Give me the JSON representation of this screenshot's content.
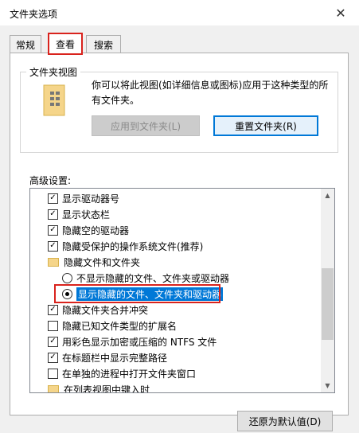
{
  "window": {
    "title": "文件夹选项",
    "close_glyph": "✕"
  },
  "tabs": [
    {
      "label": "常规"
    },
    {
      "label": "查看"
    },
    {
      "label": "搜索"
    }
  ],
  "folder_view": {
    "legend": "文件夹视图",
    "description": "你可以将此视图(如详细信息或图标)应用于这种类型的所有文件夹。",
    "apply_button": "应用到文件夹(L)",
    "reset_button": "重置文件夹(R)"
  },
  "advanced": {
    "label": "高级设置:",
    "items": [
      {
        "label": "显示驱动器号",
        "type": "checkbox",
        "checked": true
      },
      {
        "label": "显示状态栏",
        "type": "checkbox",
        "checked": true
      },
      {
        "label": "隐藏空的驱动器",
        "type": "checkbox",
        "checked": true
      },
      {
        "label": "隐藏受保护的操作系统文件(推荐)",
        "type": "checkbox",
        "checked": true
      },
      {
        "label": "隐藏文件和文件夹",
        "type": "folder"
      },
      {
        "label": "不显示隐藏的文件、文件夹或驱动器",
        "type": "radio",
        "checked": false
      },
      {
        "label": "显示隐藏的文件、文件夹和驱动器",
        "type": "radio",
        "checked": true
      },
      {
        "label": "隐藏文件夹合并冲突",
        "type": "checkbox",
        "checked": true
      },
      {
        "label": "隐藏已知文件类型的扩展名",
        "type": "checkbox",
        "checked": false
      },
      {
        "label": "用彩色显示加密或压缩的 NTFS 文件",
        "type": "checkbox",
        "checked": true
      },
      {
        "label": "在标题栏中显示完整路径",
        "type": "checkbox",
        "checked": true
      },
      {
        "label": "在单独的进程中打开文件夹窗口",
        "type": "checkbox",
        "checked": false
      },
      {
        "label": "在列表视图中键入时",
        "type": "folder"
      }
    ]
  },
  "restore_button": "还原为默认值(D)",
  "colors": {
    "highlight_red": "#d9231d",
    "selection_blue": "#0078d7"
  }
}
